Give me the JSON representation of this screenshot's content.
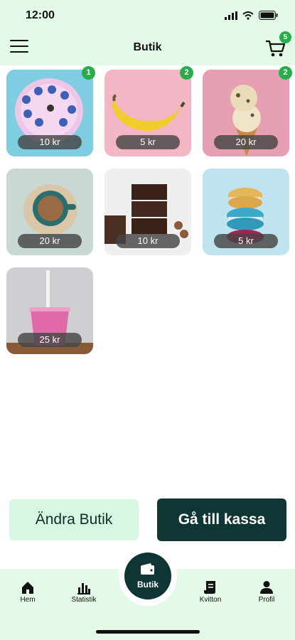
{
  "status": {
    "time": "12:00"
  },
  "header": {
    "title": "Butik",
    "cart_count": "5"
  },
  "products": [
    {
      "price": "10 kr",
      "badge": "1",
      "image": "donut"
    },
    {
      "price": "5 kr",
      "badge": "2",
      "image": "banana"
    },
    {
      "price": "20 kr",
      "badge": "2",
      "image": "ice-cream"
    },
    {
      "price": "20 kr",
      "badge": "",
      "image": "coffee"
    },
    {
      "price": "10 kr",
      "badge": "",
      "image": "brownie"
    },
    {
      "price": "5 kr",
      "badge": "",
      "image": "macarons"
    },
    {
      "price": "25 kr",
      "badge": "",
      "image": "smoothie"
    }
  ],
  "actions": {
    "change_store": "Ändra Butik",
    "checkout": "Gå till kassa"
  },
  "nav": {
    "home": "Hem",
    "stats": "Statistik",
    "store": "Butik",
    "receipts": "Kvitton",
    "profile": "Profil"
  },
  "colors": {
    "accent": "#0f3634",
    "badge": "#27ae4a",
    "light_green": "#e3fae8"
  }
}
